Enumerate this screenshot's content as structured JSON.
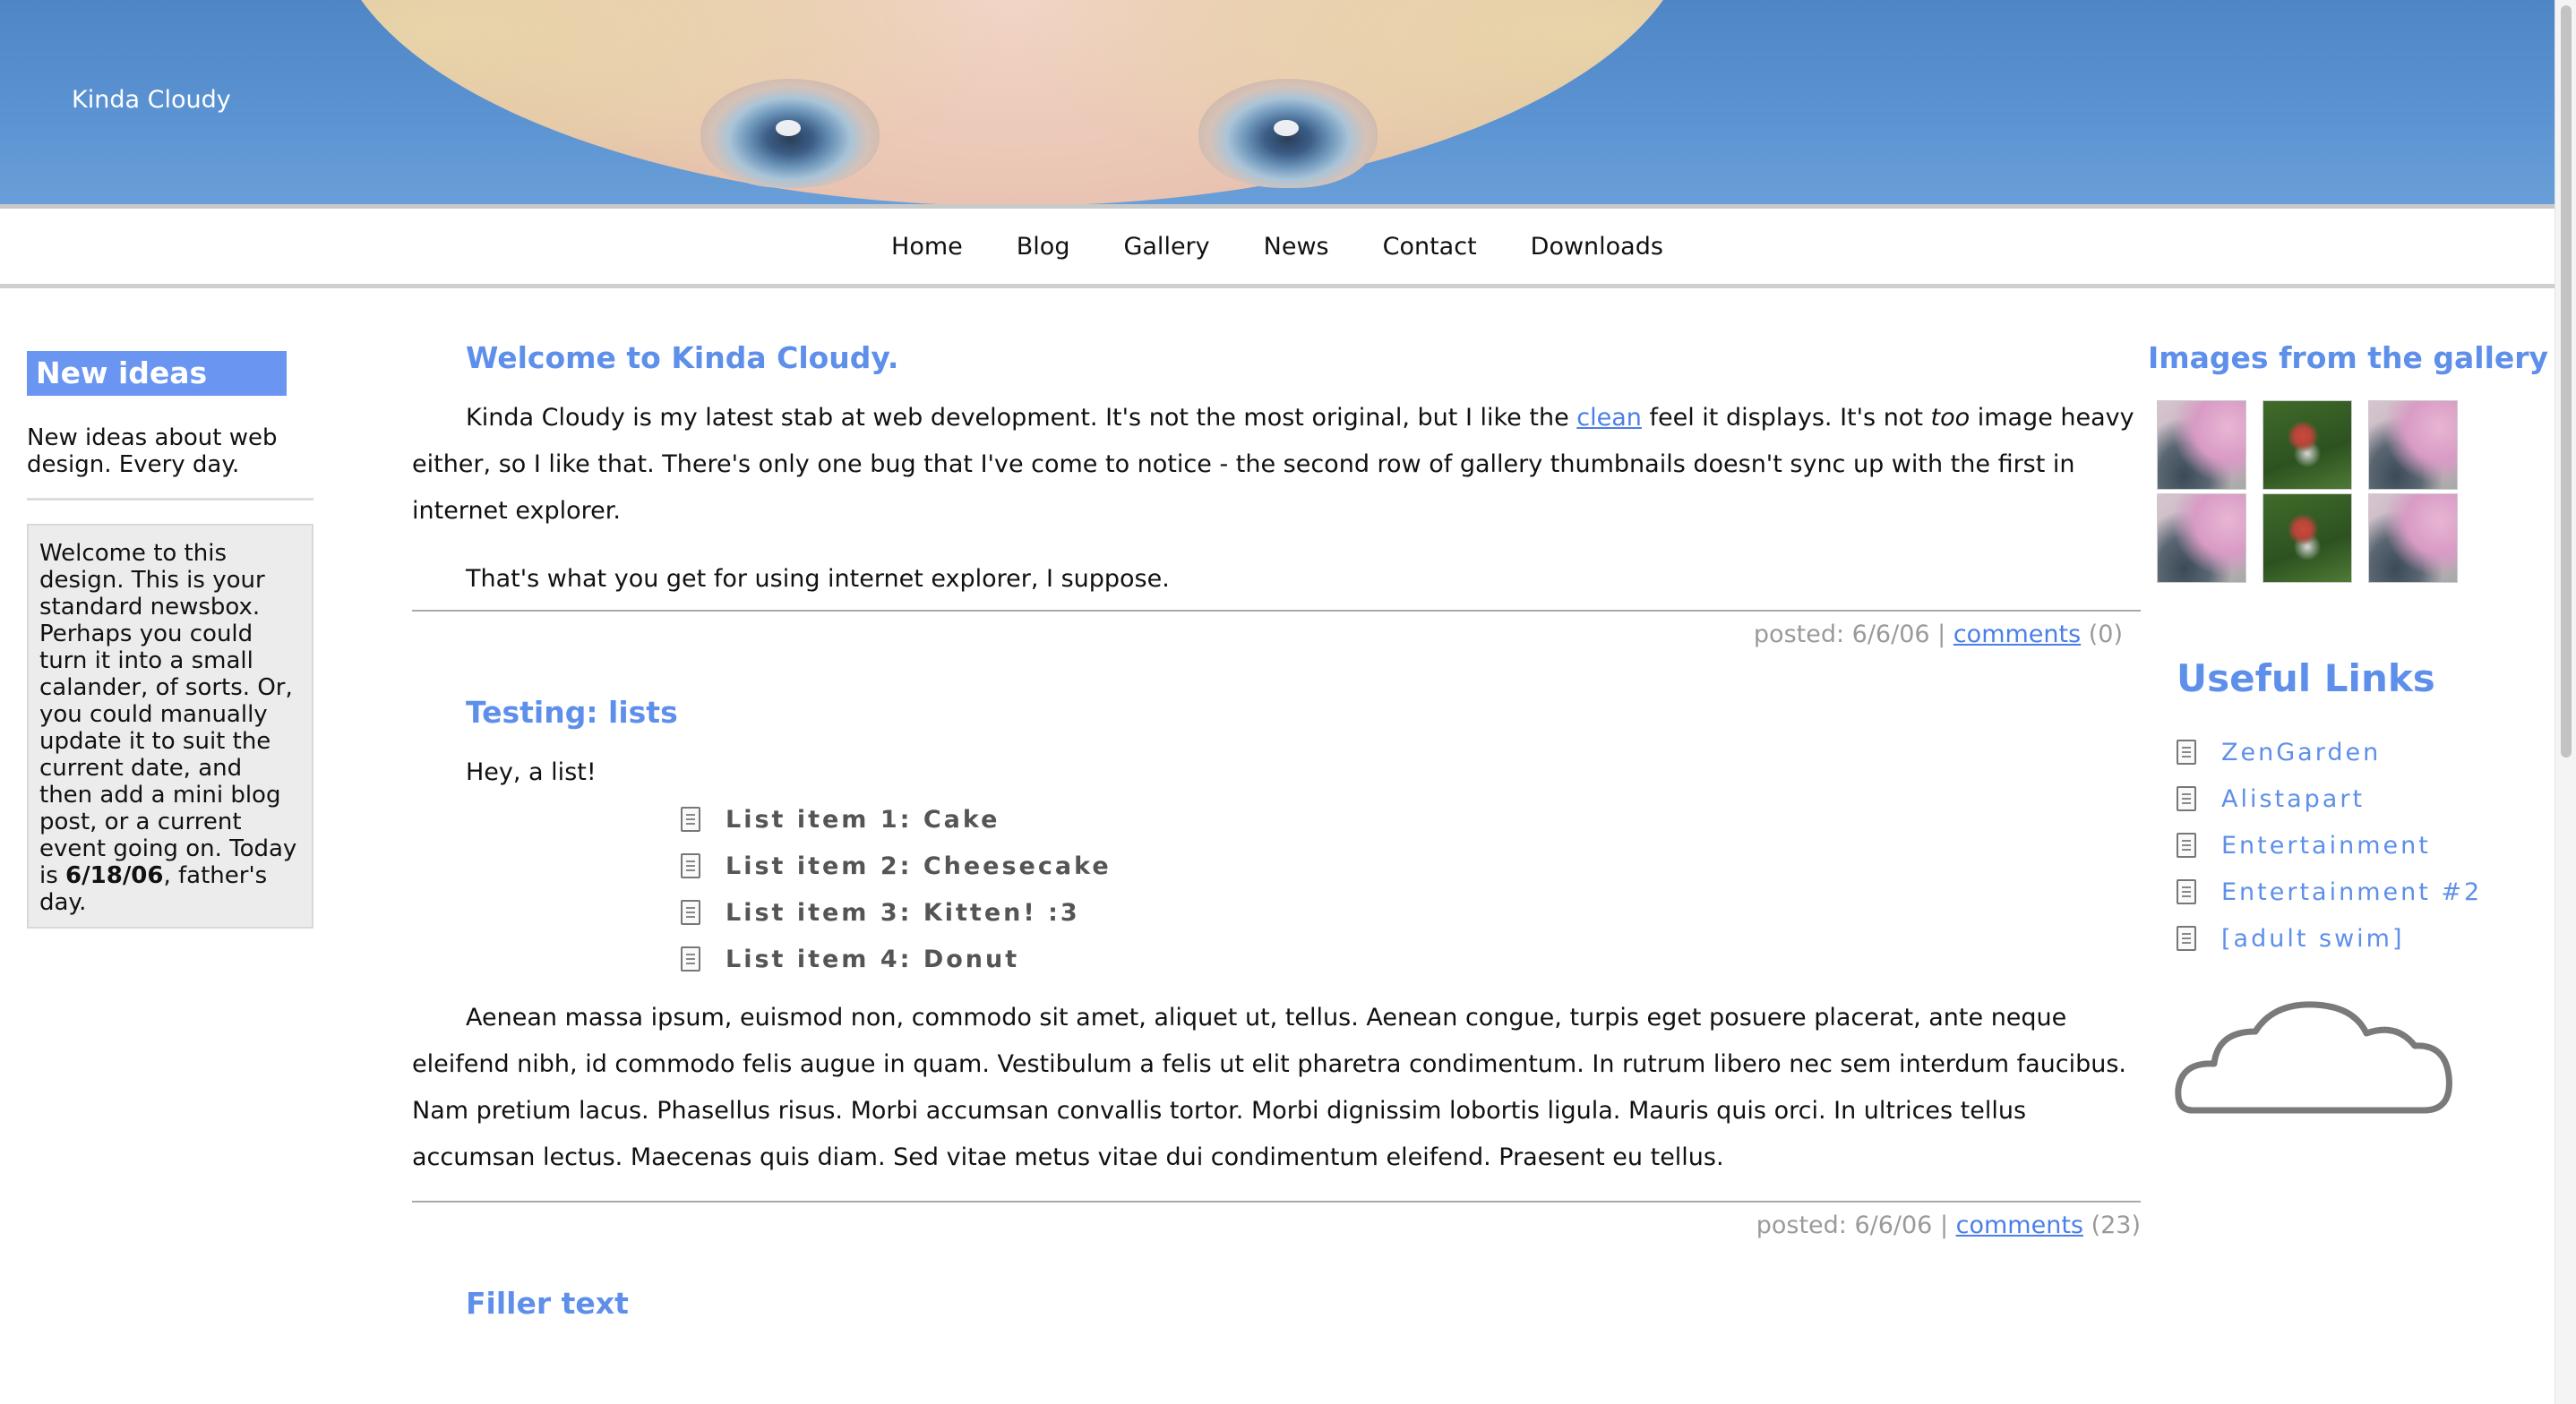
{
  "header": {
    "site_title": "Kinda Cloudy"
  },
  "nav": {
    "items": [
      "Home",
      "Blog",
      "Gallery",
      "News",
      "Contact",
      "Downloads"
    ]
  },
  "left_sidebar": {
    "heading": "New ideas",
    "tagline": "New ideas about web design. Every day.",
    "newsbox": {
      "text_before": "Welcome to this design. This is your standard newsbox. Perhaps you could turn it into a small calander, of sorts. Or, you could manually update it to suit the current date, and then add a mini blog post, or a current event going on. Today is ",
      "date": "6/18/06",
      "text_after": ", father's day."
    }
  },
  "posts": [
    {
      "title": "Welcome to Kinda Cloudy.",
      "p1_a": "Kinda Cloudy is my latest stab at web development. It's not the most original, but I like the ",
      "p1_link": "clean",
      "p1_b": " feel it displays. It's not ",
      "p1_em": "too",
      "p1_c": " image heavy either, so I like that. There's only one bug that I've come to notice - the second row of gallery thumbnails doesn't sync up with the first in internet explorer.",
      "p2": "That's what you get for using internet explorer, I suppose.",
      "meta_posted": "posted: 6/6/06 | ",
      "meta_link": "comments",
      "meta_count": " (0)"
    },
    {
      "title": "Testing: lists",
      "intro": "Hey, a list!",
      "list": [
        "List item 1: Cake",
        "List item 2: Cheesecake",
        "List item 3: Kitten! :3",
        "List item 4: Donut"
      ],
      "body": "Aenean massa ipsum, euismod non, commodo sit amet, aliquet ut, tellus. Aenean congue, turpis eget posuere placerat, ante neque eleifend nibh, id commodo felis augue in quam. Vestibulum a felis ut elit pharetra condimentum. In rutrum libero nec sem interdum faucibus. Nam pretium lacus. Phasellus risus. Morbi accumsan convallis tortor. Morbi dignissim lobortis ligula. Mauris quis orci. In ultrices tellus accumsan lectus. Maecenas quis diam. Sed vitae metus vitae dui condimentum eleifend. Praesent eu tellus.",
      "meta_posted": "posted: 6/6/06 | ",
      "meta_link": "comments",
      "meta_count": " (23)"
    },
    {
      "title": "Filler text"
    }
  ],
  "right_sidebar": {
    "gallery_title": "Images from the gallery",
    "thumbnails": [
      "pink-flower-thumb",
      "garden-gnome-thumb",
      "pink-flower-thumb",
      "pink-flower-thumb",
      "garden-gnome-thumb",
      "pink-flower-thumb"
    ],
    "links_title": "Useful Links",
    "links": [
      "ZenGarden",
      "Alistapart",
      "Entertainment",
      "Entertainment #2",
      "[adult swim]"
    ],
    "cloud_icon": "cloud-icon"
  },
  "colors": {
    "accent": "#5e8fea",
    "heading_bg": "#6a95f0",
    "banner_sky": "#5b93d2"
  }
}
